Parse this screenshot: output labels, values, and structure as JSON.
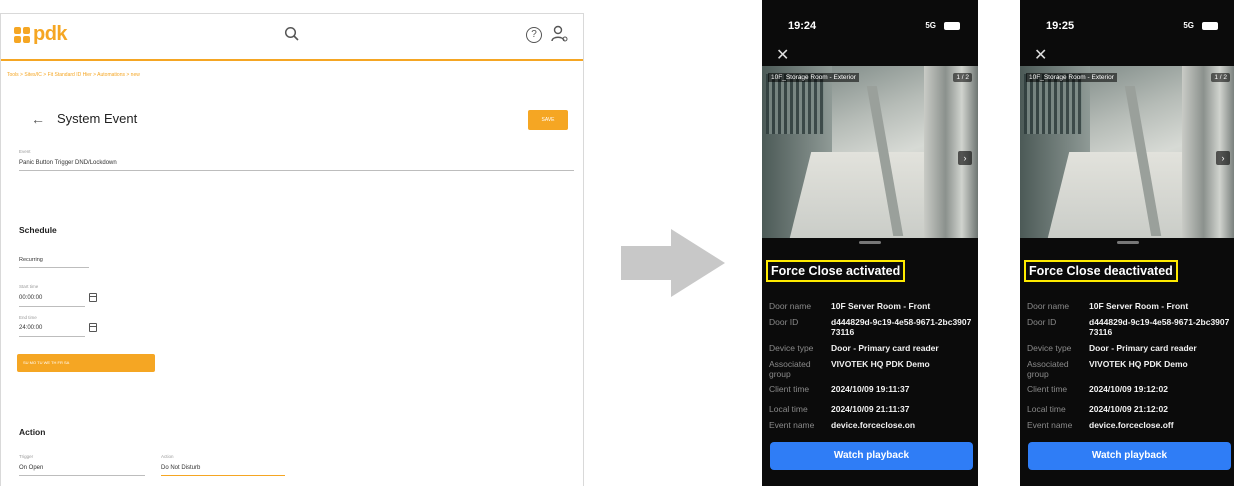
{
  "web": {
    "logo_text": "pdk",
    "breadcrumb": "Tools > Sites/IC > Fit Standard ID Hier > Automations > new",
    "back_icon": "arrow-left-icon",
    "title": "System Event",
    "save_label": "SAVE",
    "event_label": "Event",
    "event_value": "Panic Button Trigger DND/Lockdown",
    "schedule_heading": "Schedule",
    "recurring_value": "Recurring",
    "start_label": "Start time",
    "start_value": "00:00:00",
    "end_label": "End time",
    "end_value": "24:00:00",
    "days_value": "SU  MO  TU  WE  TH  FR  SA",
    "action_heading": "Action",
    "trigger_label": "Trigger",
    "trigger_value": "On Open",
    "action_label": "Action",
    "action_value": "Do Not Disturb",
    "accent_color": "#f5a623"
  },
  "phones": [
    {
      "time": "19:24",
      "network": "5G",
      "camera_label": "10F_Storage Room - Exterior",
      "camera_count": "1 / 2",
      "event_title": "Force Close activated",
      "rows": [
        {
          "k": "Door name",
          "v": "10F Server Room - Front"
        },
        {
          "k": "Door ID",
          "v": "d444829d-9c19-4e58-9671-2bc390773116"
        },
        {
          "k": "Device type",
          "v": "Door - Primary card reader"
        },
        {
          "k": "Associated group",
          "v": "VIVOTEK HQ PDK Demo"
        },
        {
          "k": "Client time",
          "v": "2024/10/09 19:11:37"
        },
        {
          "k": "Local time",
          "v": "2024/10/09 21:11:37"
        },
        {
          "k": "Event name",
          "v": "device.forceclose.on"
        }
      ],
      "watch_label": "Watch playback"
    },
    {
      "time": "19:25",
      "network": "5G",
      "camera_label": "10F_Storage Room - Exterior",
      "camera_count": "1 / 2",
      "event_title": "Force Close deactivated",
      "rows": [
        {
          "k": "Door name",
          "v": "10F Server Room - Front"
        },
        {
          "k": "Door ID",
          "v": "d444829d-9c19-4e58-9671-2bc390773116"
        },
        {
          "k": "Device type",
          "v": "Door - Primary card reader"
        },
        {
          "k": "Associated group",
          "v": "VIVOTEK HQ PDK Demo"
        },
        {
          "k": "Client time",
          "v": "2024/10/09 19:12:02"
        },
        {
          "k": "Local time",
          "v": "2024/10/09 21:12:02"
        },
        {
          "k": "Event name",
          "v": "device.forceclose.off"
        }
      ],
      "watch_label": "Watch playback"
    }
  ],
  "highlight_color": "#ffeb00",
  "button_color": "#2f7df6"
}
